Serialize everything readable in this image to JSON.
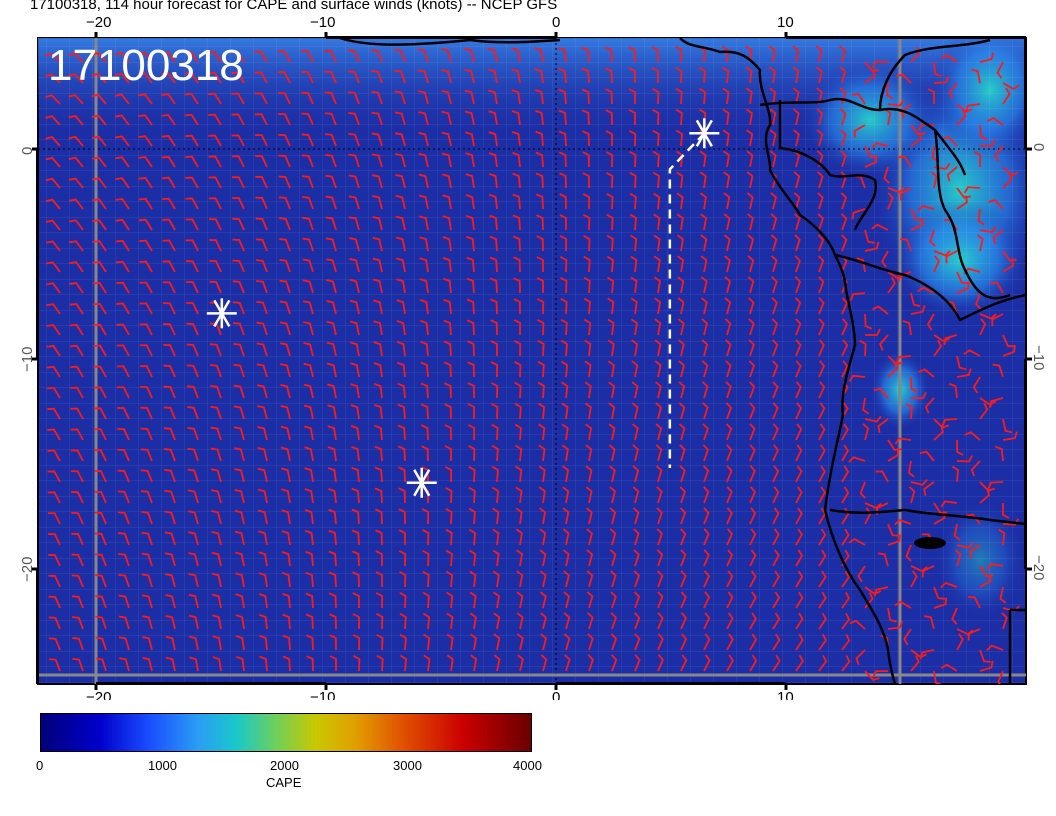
{
  "title": "17100318, 114 hour forecast for CAPE and surface winds (knots) -- NCEP GFS",
  "stamp": "17100318",
  "map": {
    "lon_range": [
      -22.5,
      20.5
    ],
    "lat_range": [
      -25.5,
      5
    ],
    "top_lon_ticks": [
      "−20",
      "−10",
      "0",
      "10"
    ],
    "bottom_lon_ticks": [
      "−20",
      "−10",
      "0",
      "10"
    ],
    "left_lat_ticks": [
      "0",
      "−10",
      "−20"
    ],
    "right_lat_ticks": [
      "0",
      "−10",
      "−20"
    ],
    "ocean_color": "#1c2ea6",
    "wind_barb_color": "#ff1a1a",
    "coast_color": "#000000",
    "markers": [
      {
        "name": "star-marker",
        "lon": 6.5,
        "lat": 0.5
      },
      {
        "name": "star-marker",
        "lon": -14.5,
        "lat": -8
      },
      {
        "name": "star-marker",
        "lon": -5.8,
        "lat": -16
      }
    ],
    "track": [
      [
        6.5,
        0.5
      ],
      [
        5,
        -1.2
      ],
      [
        5,
        -15.3
      ]
    ]
  },
  "colorbar": {
    "label": "CAPE",
    "ticks": [
      "0",
      "1000",
      "2000",
      "3000",
      "4000"
    ]
  }
}
